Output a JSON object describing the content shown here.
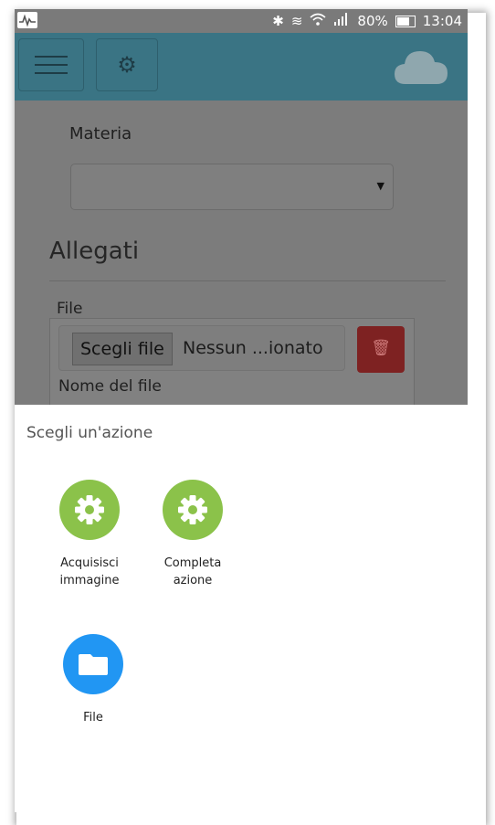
{
  "status_bar": {
    "battery": "80%",
    "time": "13:04",
    "icons": [
      "activity-icon",
      "bluetooth-icon",
      "nfc-icon",
      "wifi-icon",
      "signal-icon",
      "battery-icon"
    ]
  },
  "toolbar": {
    "menu_icon": "menu-icon",
    "settings_icon": "gear-icon",
    "cloud_icon": "cloud-icon",
    "color": "#3a7484"
  },
  "form": {
    "materia_label": "Materia",
    "materia_value": "",
    "allegati_heading": "Allegati",
    "file_label": "File",
    "choose_file_button": "Scegli file",
    "no_file_text": "Nessun ...ionato",
    "file_name_label": "Nome del file",
    "delete_color": "#d32f2f"
  },
  "chooser": {
    "title": "Scegli un'azione",
    "items": [
      {
        "label_line1": "Acquisisci",
        "label_line2": "immagine",
        "icon": "gear-icon",
        "color": "#8bc24a"
      },
      {
        "label_line1": "Completa",
        "label_line2": "azione",
        "icon": "gear-icon",
        "color": "#8bc24a"
      },
      {
        "label_line1": "File",
        "label_line2": "",
        "icon": "folder-icon",
        "color": "#2196f3"
      }
    ]
  }
}
